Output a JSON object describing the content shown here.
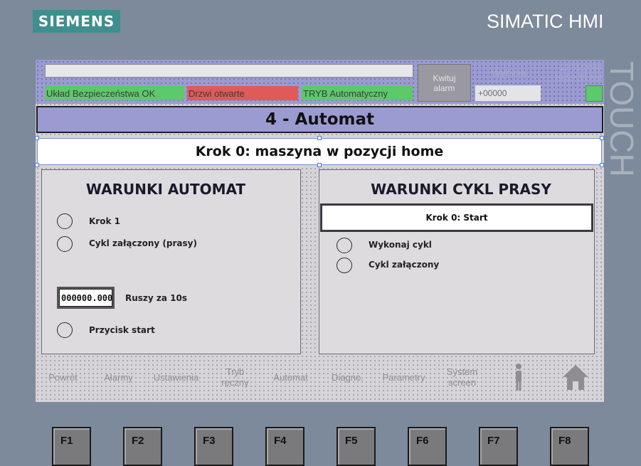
{
  "bezel": {
    "brand_logo": "SIEMENS",
    "product": "SIMATIC HMI",
    "touch_label": "TOUCH"
  },
  "header": {
    "status": {
      "safety": "Układ Bezpieczeństwa OK",
      "door": "Drzwi otwarte",
      "mode": "TRYB Automatyczny"
    },
    "ack_button": "Kwituj alarm",
    "counter_label": "Wybicia",
    "counter_value": "+00000",
    "date": "12/31/2000",
    "time": "10:59:39 AM",
    "colors": {
      "ok": "#5cc96a",
      "alarm": "#e05a5a",
      "header": "#9b9bd2"
    }
  },
  "screen": {
    "title": "4 - Automat",
    "step_text": "Krok 0: maszyna w pozycji home"
  },
  "left_panel": {
    "title": "WARUNKI AUTOMAT",
    "items": [
      "Krok 1",
      "Cykl załączony (prasy)"
    ],
    "timer_value": "000000.000",
    "timer_label": "Ruszy za 10s",
    "start_label": "Przycisk start"
  },
  "right_panel": {
    "title": "WARUNKI CYKL PRASY",
    "step_text": "Krok 0: Start",
    "items": [
      "Wykonaj cykl",
      "Cykl załączony"
    ]
  },
  "nav": {
    "items": [
      "Powrót",
      "Alarmy",
      "Ustawienia",
      "Tryb ręczny",
      "Automat",
      "Diagno.",
      "Parametry",
      "System screen"
    ],
    "icons": [
      "user-icon",
      "home-icon"
    ]
  },
  "fkeys": [
    "F1",
    "F2",
    "F3",
    "F4",
    "F5",
    "F6",
    "F7",
    "F8"
  ]
}
